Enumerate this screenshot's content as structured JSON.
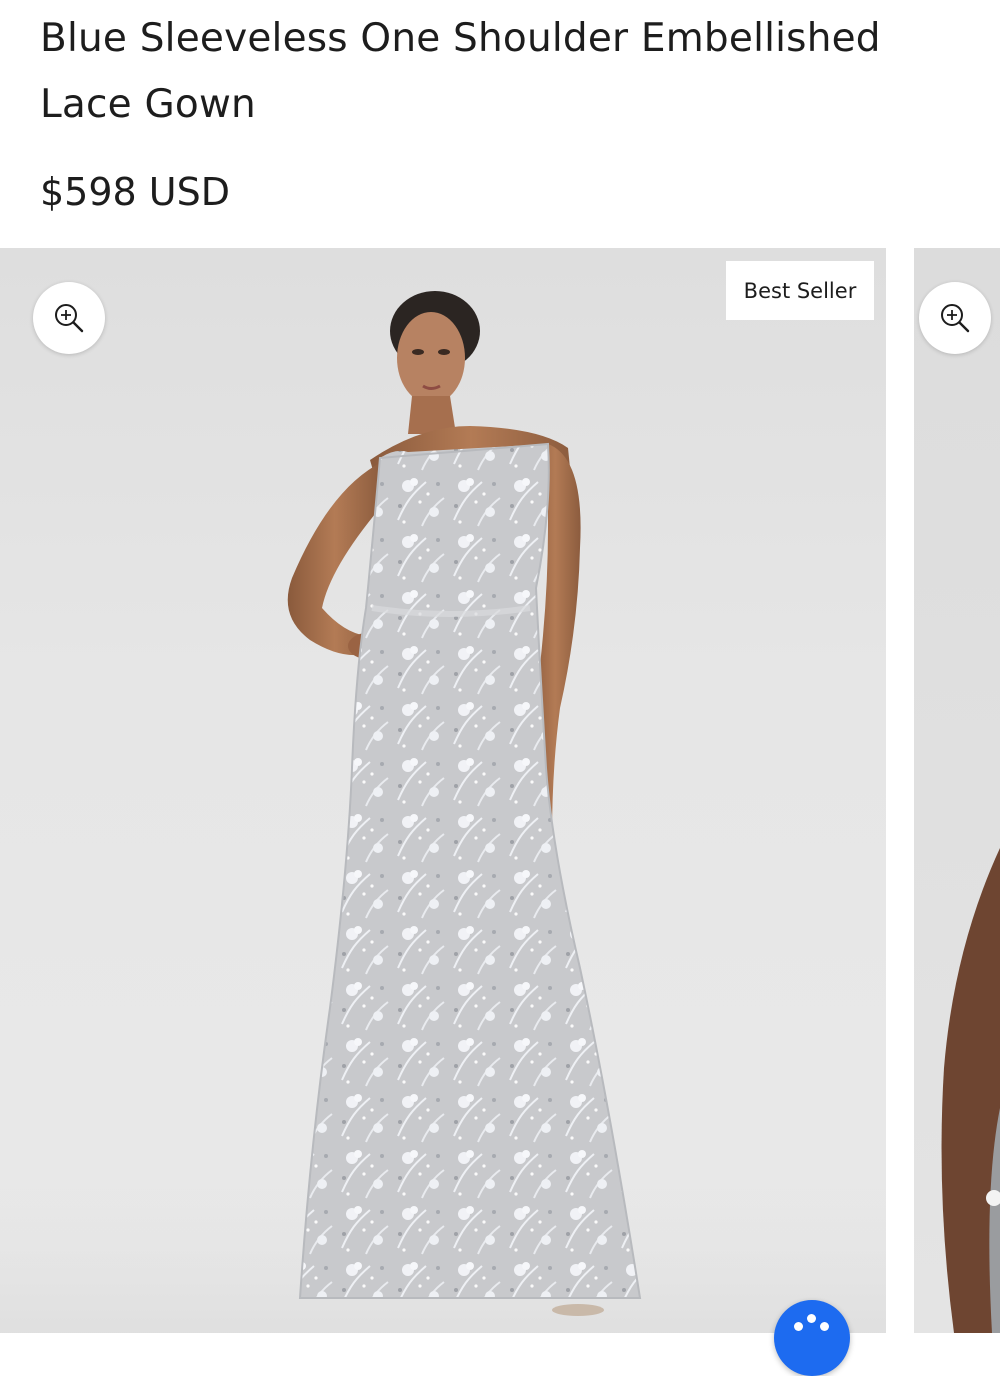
{
  "product": {
    "title": "Blue Sleeveless One Shoulder Embellished Lace Gown",
    "price": "$598 USD"
  },
  "gallery": {
    "badge": "Best Seller",
    "zoom_icon": "zoom-in-icon",
    "chat_icon": "chat-icon"
  },
  "colors": {
    "text": "#1d1d1d",
    "background": "#ffffff",
    "photo_backdrop": "#e4e4e4",
    "chat_button": "#1d6bf0"
  }
}
